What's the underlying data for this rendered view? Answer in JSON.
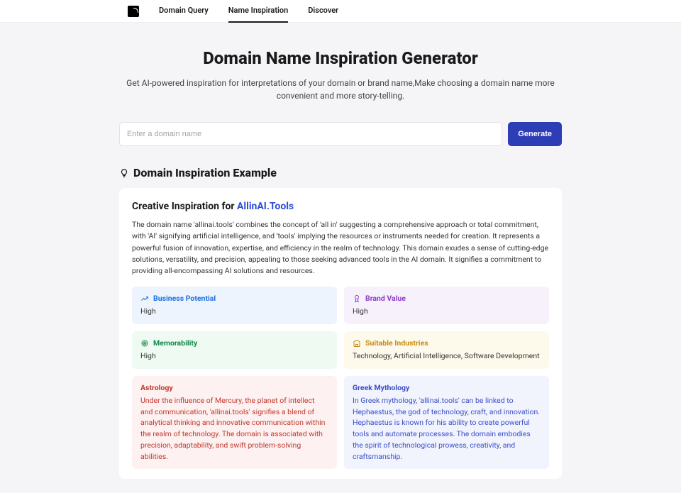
{
  "nav": {
    "items": [
      "Domain Query",
      "Name Inspiration",
      "Discover"
    ],
    "activeIndex": 1
  },
  "page": {
    "title": "Domain Name Inspiration Generator",
    "subtitle": "Get AI-powered inspiration for interpretations of your domain or brand name,Make choosing a domain name more convenient and more story-telling."
  },
  "search": {
    "placeholder": "Enter a domain name",
    "buttonLabel": "Generate"
  },
  "example": {
    "heading": "Domain Inspiration Example",
    "titlePrefix": "Creative Inspiration for ",
    "brand": "AllinAI.Tools",
    "description": "The domain name 'allinai.tools' combines the concept of 'all in' suggesting a comprehensive approach or total commitment, with 'AI' signifying artificial intelligence, and 'tools' implying the resources or instruments needed for creation. It represents a powerful fusion of innovation, expertise, and efficiency in the realm of technology. This domain exudes a sense of cutting-edge solutions, versatility, and precision, appealing to those seeking advanced tools in the AI domain. It signifies a commitment to providing all-encompassing AI solutions and resources.",
    "metrics": {
      "businessPotential": {
        "label": "Business Potential",
        "value": "High"
      },
      "brandValue": {
        "label": "Brand Value",
        "value": "High"
      },
      "memorability": {
        "label": "Memorability",
        "value": "High"
      },
      "suitableIndustries": {
        "label": "Suitable Industries",
        "value": "Technology, Artificial Intelligence, Software Development"
      },
      "astrology": {
        "label": "Astrology",
        "value": "Under the influence of Mercury, the planet of intellect and communication, 'allinai.tools' signifies a blend of analytical thinking and innovative communication within the realm of technology. The domain is associated with precision, adaptability, and swift problem-solving abilities."
      },
      "greekMythology": {
        "label": "Greek Mythology",
        "value": "In Greek mythology, 'allinai.tools' can be linked to Hephaestus, the god of technology, craft, and innovation. Hephaestus is known for his ability to create powerful tools and automate processes. The domain embodies the spirit of technological prowess, creativity, and craftsmanship."
      }
    }
  }
}
